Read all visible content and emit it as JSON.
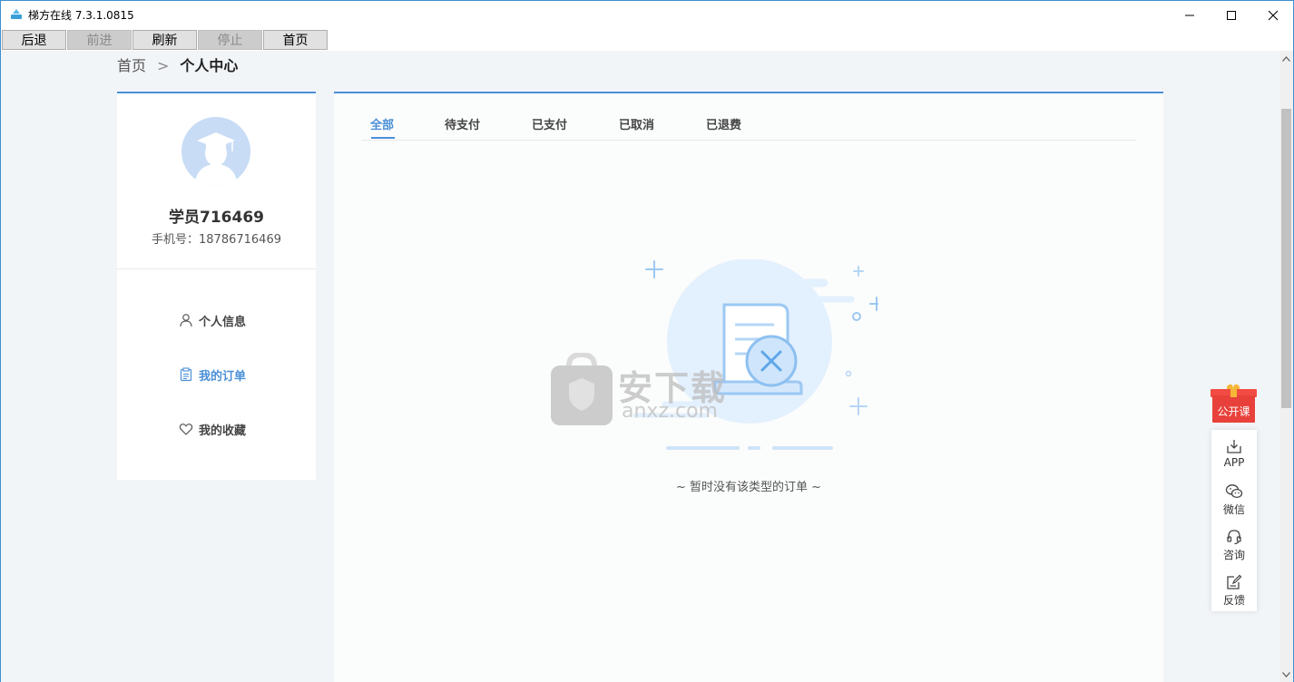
{
  "window": {
    "title": "梯方在线 7.3.1.0815"
  },
  "nav": {
    "back": "后退",
    "forward": "前进",
    "refresh": "刷新",
    "stop": "停止",
    "home": "首页"
  },
  "breadcrumb": {
    "home": "首页",
    "separator": ">",
    "current": "个人中心"
  },
  "profile": {
    "name": "学员716469",
    "phone_label": "手机号：",
    "phone": "18786716469"
  },
  "menu": {
    "items": [
      {
        "label": "个人信息",
        "icon": "user-icon",
        "active": false
      },
      {
        "label": "我的订单",
        "icon": "clipboard-icon",
        "active": true
      },
      {
        "label": "我的收藏",
        "icon": "heart-icon",
        "active": false
      }
    ]
  },
  "orders": {
    "tabs": [
      "全部",
      "待支付",
      "已支付",
      "已取消",
      "已退费"
    ],
    "active_tab": "全部",
    "empty_text": "~ 暂时没有该类型的订单 ~"
  },
  "watermark": {
    "cn": "安下载",
    "en": "anxz.com"
  },
  "floating": {
    "gift_label": "公开课",
    "items": [
      {
        "label": "APP",
        "icon": "download-icon"
      },
      {
        "label": "微信",
        "icon": "wechat-icon"
      },
      {
        "label": "咨询",
        "icon": "headset-icon"
      },
      {
        "label": "反馈",
        "icon": "feedback-icon"
      }
    ]
  },
  "colors": {
    "accent": "#4a8fd6",
    "gift_red": "#e8413b",
    "background": "#f2f5f8"
  }
}
